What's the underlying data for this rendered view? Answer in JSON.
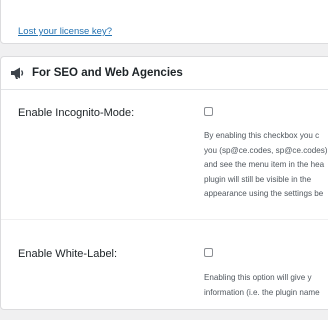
{
  "license": {
    "lost_key_link": "Lost your license key?"
  },
  "seo_section": {
    "title": "For SEO and Web Agencies",
    "icon": "megaphone-icon",
    "incognito": {
      "label": "Enable Incognito-Mode:",
      "checked": false,
      "description_lines": [
        "By enabling this checkbox you c",
        "you (sp@ce.codes, sp@ce.codes)",
        "and see the menu item in the hea",
        "plugin will still be visible in the",
        "appearance using the settings be"
      ]
    },
    "white_label": {
      "label": "Enable White-Label:",
      "checked": false,
      "description_lines": [
        "Enabling this option will give y",
        "information (i.e. the plugin name"
      ]
    }
  },
  "colors": {
    "link": "#2271b1",
    "background": "#f0f0f1",
    "card": "#ffffff"
  }
}
